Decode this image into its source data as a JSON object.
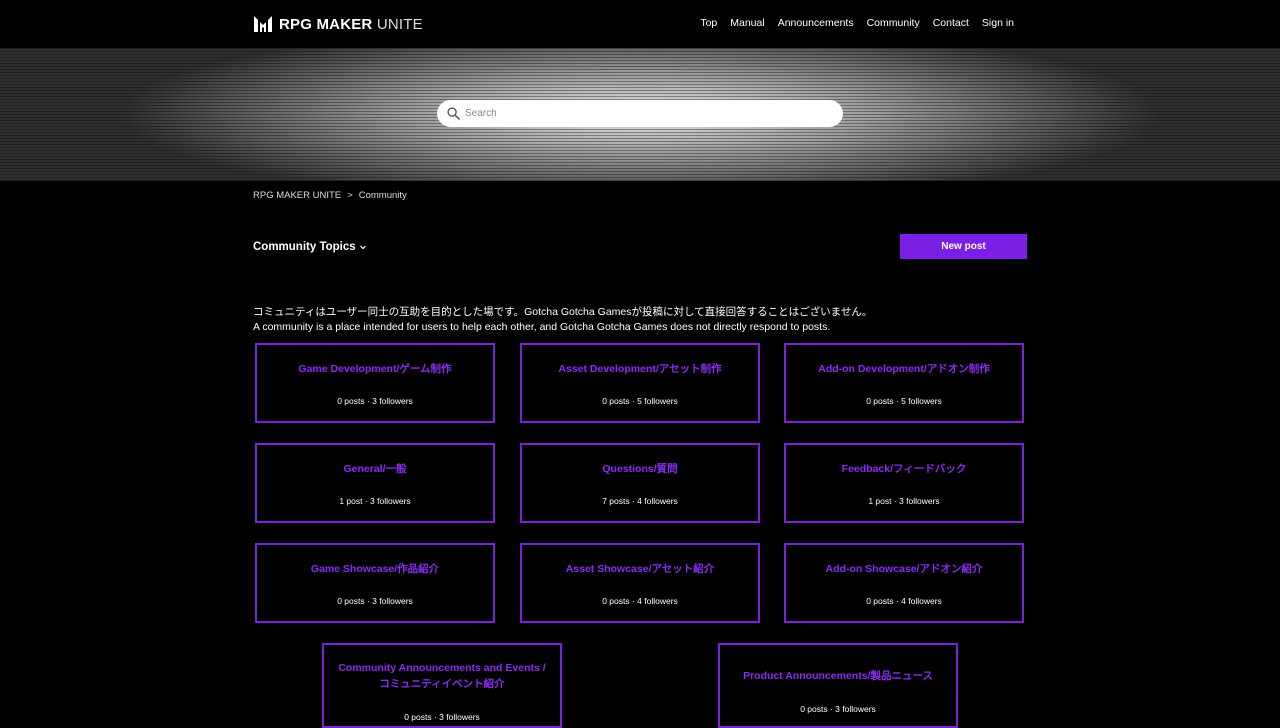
{
  "brand": {
    "name_bold": "RPG MAKER",
    "name_light": "UNITE"
  },
  "nav": {
    "items": [
      "Top",
      "Manual",
      "Announcements",
      "Community",
      "Contact",
      "Sign in"
    ]
  },
  "search": {
    "placeholder": "Search"
  },
  "breadcrumb": {
    "items": [
      "RPG MAKER UNITE",
      "Community"
    ],
    "separator": ">"
  },
  "topics": {
    "title": "Community Topics",
    "new_post_label": "New post"
  },
  "notice": {
    "ja": "コミュニティはユーザー同士の互助を目的とした場です。Gotcha Gotcha Gamesが投稿に対して直接回答することはございません。",
    "en": "A community is a place intended for users to help each other, and Gotcha Gotcha Games does not directly respond to posts."
  },
  "cards": [
    {
      "title": "Game Development/ゲーム制作",
      "stats": "0 posts ·  3 followers"
    },
    {
      "title": "Asset Development/アセット制作",
      "stats": "0 posts ·  5 followers"
    },
    {
      "title": "Add-on Development/アドオン制作",
      "stats": "0 posts ·  5 followers"
    },
    {
      "title": "General/一般",
      "stats": "1 post ·  3 followers"
    },
    {
      "title": "Questions/質問",
      "stats": "7 posts ·  4 followers"
    },
    {
      "title": "Feedback/フィードバック",
      "stats": "1 post ·  3 followers"
    },
    {
      "title": "Game Showcase/作品紹介",
      "stats": "0 posts ·  3 followers"
    },
    {
      "title": "Asset Showcase/アセット紹介",
      "stats": "0 posts ·  4 followers"
    },
    {
      "title": "Add-on Showcase/アドオン紹介",
      "stats": "0 posts ·  4 followers"
    },
    {
      "title": "Community Announcements and Events / コミュニティイベント紹介",
      "stats": "0 posts ·  3 followers"
    },
    {
      "title": "Product Announcements/製品ニュース",
      "stats": "0 posts ·  3 followers"
    }
  ],
  "colors": {
    "accent": "#8b2bf0",
    "button": "#7a1fe6",
    "card_border": "#7a22d8"
  }
}
